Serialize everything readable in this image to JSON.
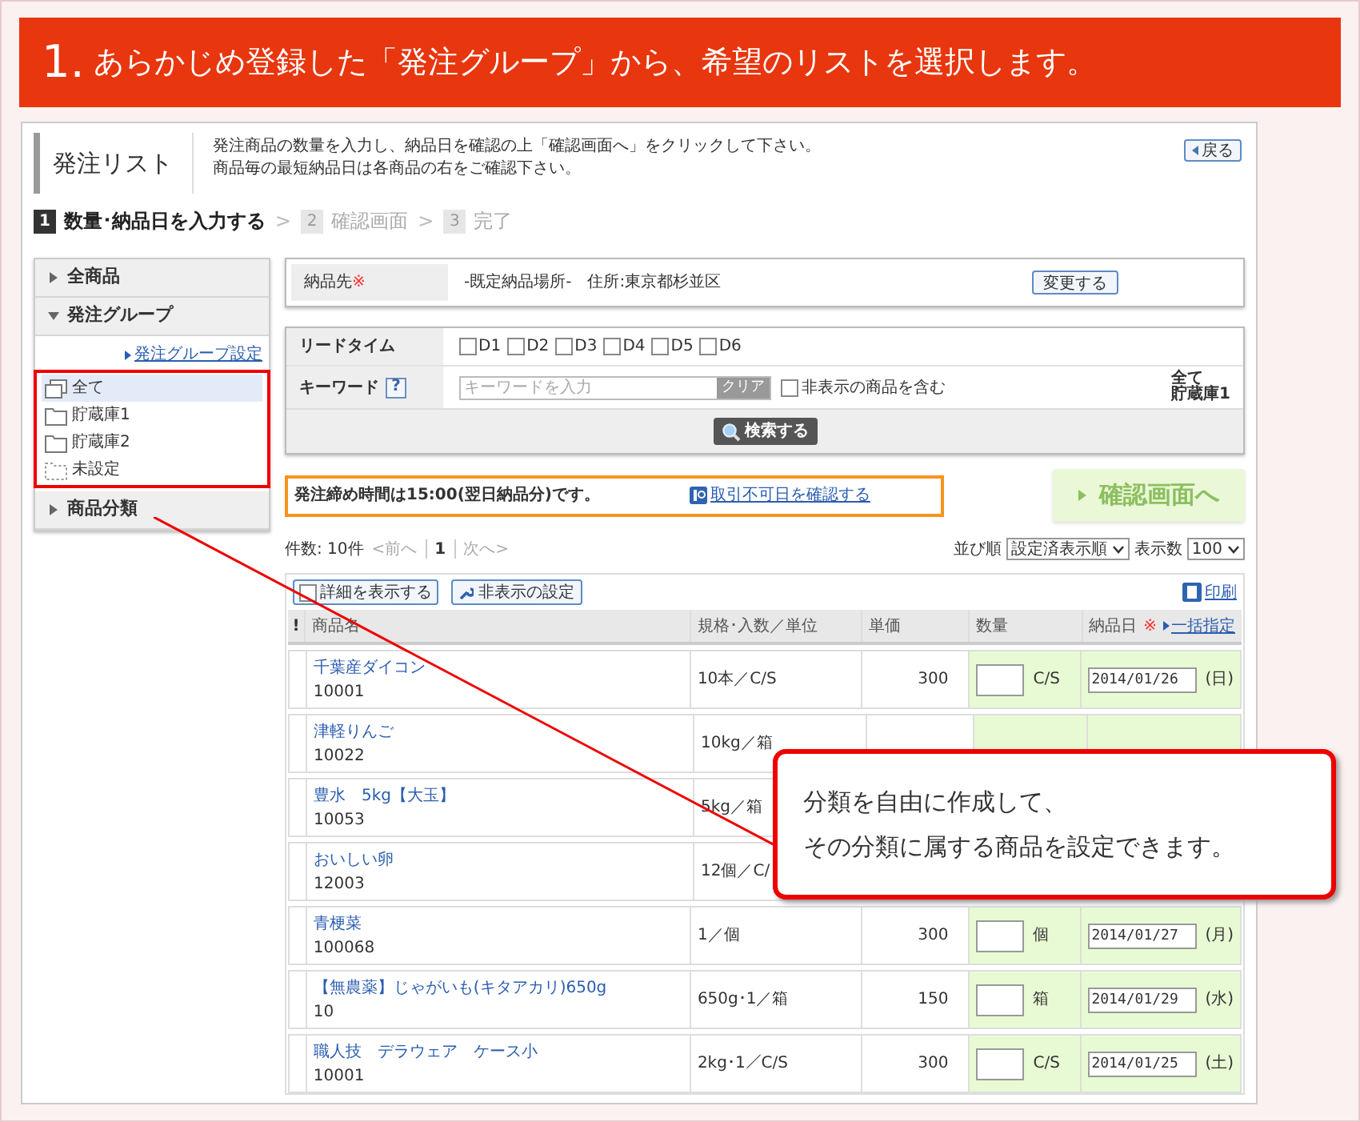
{
  "banner": {
    "number": "1.",
    "title": "あらかじめ登録した「発注グループ」から、希望のリストを選択します。"
  },
  "page": {
    "title": "発注リスト",
    "description": [
      "発注商品の数量を入力し、納品日を確認の上「確認画面へ」をクリックして下さい。",
      "商品毎の最短納品日は各商品の右をご確認下さい。"
    ],
    "back_button": "戻る"
  },
  "steps": [
    {
      "number": "1",
      "label": "数量･納品日を入力する",
      "selected": true,
      "separator": ">"
    },
    {
      "number": "2",
      "label": "確認画面",
      "selected": false,
      "separator": ">"
    },
    {
      "number": "3",
      "label": "完了",
      "selected": false
    }
  ],
  "sidebar": {
    "sections": [
      {
        "label": "全商品",
        "expanded": false
      },
      {
        "label": "発注グループ",
        "expanded": true,
        "link": "発注グループ設定",
        "items": [
          {
            "label": "全て",
            "kind": "all",
            "selected": true
          },
          {
            "label": "貯蔵庫1",
            "kind": "folder",
            "selected": false
          },
          {
            "label": "貯蔵庫2",
            "kind": "folder",
            "selected": false
          },
          {
            "label": "未設定",
            "kind": "unset",
            "selected": false
          }
        ]
      },
      {
        "label": "商品分類",
        "expanded": false
      }
    ]
  },
  "delivery": {
    "label": "納品先",
    "required_mark": "※",
    "value": "-既定納品場所-　住所:東京都杉並区",
    "button": "変更する"
  },
  "search": {
    "lead_time_label": "リードタイム",
    "lead_times": [
      {
        "label": "D1",
        "checked": false
      },
      {
        "label": "D2",
        "checked": false
      },
      {
        "label": "D3",
        "checked": false
      },
      {
        "label": "D4",
        "checked": false
      },
      {
        "label": "D5",
        "checked": false
      },
      {
        "label": "D6",
        "checked": false
      }
    ],
    "keyword_label": "キーワード",
    "help": "?",
    "placeholder": "キーワードを入力",
    "clear_button": "クリア",
    "include_hidden": {
      "label": "非表示の商品を含む",
      "checked": false
    },
    "group_note": [
      "全て",
      "貯蔵庫1"
    ],
    "search_button": "検索する"
  },
  "notice": {
    "text": "発注締め時間は15:00(翌日納品分)です。",
    "link": "取引不可日を確認する"
  },
  "confirm_button": {
    "label": "確認画面へ",
    "disabled": true
  },
  "pager": {
    "count": "件数: 10件",
    "prev": "<前へ",
    "page": "1",
    "next": "次へ>"
  },
  "sort": {
    "label": "並び順",
    "value": "設定済表示順",
    "count_label": "表示数",
    "count_value": "100"
  },
  "toolbar": {
    "details": {
      "label": "詳細を表示する",
      "checked": false
    },
    "hidden_settings": "非表示の設定",
    "print": "印刷"
  },
  "table": {
    "columns": [
      "!",
      "商品名",
      "規格･入数／単位",
      "単価",
      "数量",
      "納品日"
    ],
    "required_mark": "※",
    "bulk_link": "一括指定",
    "rows": [
      {
        "name": "千葉産ダイコン",
        "code": "10001",
        "spec": "10本／C/S",
        "price": "300",
        "unit": "C/S",
        "date": "2014/01/26",
        "weekday": "(日)"
      },
      {
        "name": "津軽りんご",
        "code": "10022",
        "spec": "10kg／箱"
      },
      {
        "name": "豊水　5kg【大玉】",
        "code": "10053",
        "spec": "5kg／箱"
      },
      {
        "name": "おいしい卵",
        "code": "12003",
        "spec": "12個／C/"
      },
      {
        "name": "青梗菜",
        "code": "100068",
        "spec": "1／個",
        "price": "300",
        "unit": "個",
        "date": "2014/01/27",
        "weekday": "(月)"
      },
      {
        "name": "【無農薬】じゃがいも(キタアカリ)650g",
        "code": "10",
        "spec": "650g･1／箱",
        "price": "150",
        "unit": "箱",
        "date": "2014/01/29",
        "weekday": "(水)"
      },
      {
        "name": "職人技　デラウェア　ケース小",
        "code": "10001",
        "spec": "2kg･1／C/S",
        "price": "300",
        "unit": "C/S",
        "date": "2014/01/25",
        "weekday": "(土)"
      }
    ]
  },
  "callout": {
    "lines": [
      "分類を自由に作成して、",
      "その分類に属する商品を設定できます。"
    ]
  }
}
